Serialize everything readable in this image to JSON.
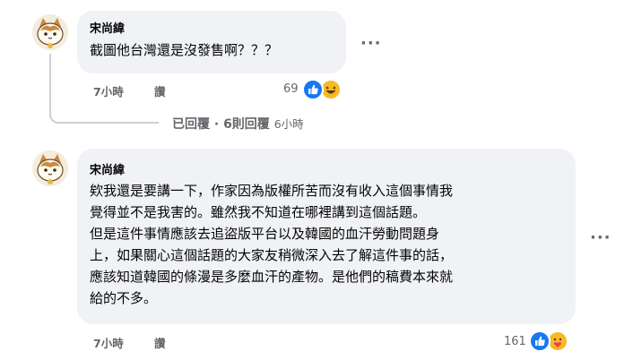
{
  "comment1": {
    "author": "宋尚緯",
    "text": "截圖他台灣還是沒發售啊？？？",
    "time": "7小時",
    "action": "讚",
    "reaction_count": "69",
    "reactions": [
      "like-icon",
      "haha-icon"
    ],
    "replies_label": "已回覆 · 6則回覆",
    "replies_time": "6小時"
  },
  "comment2": {
    "author": "宋尚緯",
    "lines": [
      "欸我還是要講一下，作家因為版權所苦而沒有收入這個事情我",
      "覺得並不是我害的。雖然我不知道在哪裡講到這個話題。",
      "但是這件事情應該去追盜版平台以及韓國的血汗勞動問題身",
      "上，如果關心這個話題的大家友稍微深入去了解這件事的話，",
      "應該知道韓國的條漫是多麼血汗的產物。是他們的稿費本來就",
      "給的不多。"
    ],
    "time": "7小時",
    "action": "讚",
    "reaction_count": "161",
    "reactions": [
      "like-icon",
      "care-icon"
    ]
  },
  "more_options": "···",
  "colors": {
    "bubble": "#f0f2f5",
    "meta": "#65676b",
    "like_blue": "#1877f2",
    "haha_yellow": "#f7b928"
  }
}
